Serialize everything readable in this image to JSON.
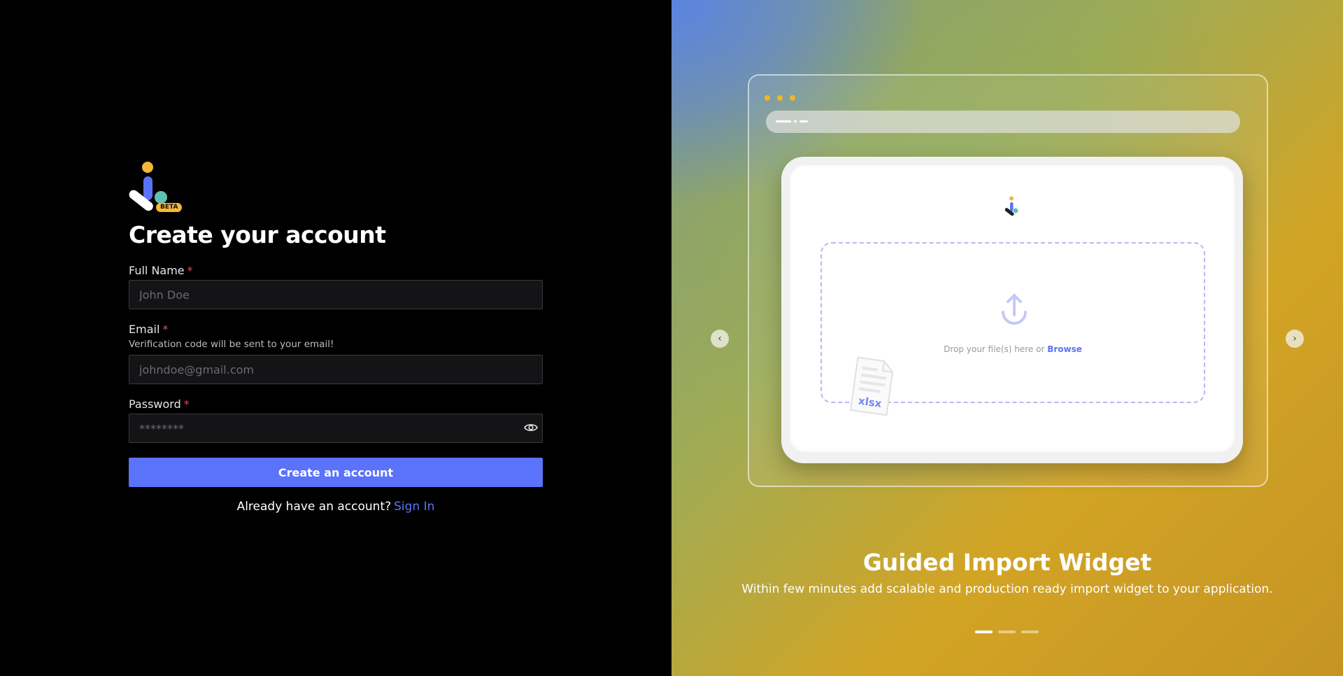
{
  "brand": {
    "badge": "BETA",
    "colors": {
      "accent": "#5b72fb",
      "yellow": "#f4b73a",
      "teal": "#5fc0b2",
      "required": "#e5484d"
    }
  },
  "form": {
    "title": "Create your account",
    "full_name": {
      "label": "Full Name",
      "required": "*",
      "placeholder": "John Doe",
      "value": ""
    },
    "email": {
      "label": "Email",
      "required": "*",
      "hint": "Verification code will be sent to your email!",
      "placeholder": "johndoe@gmail.com",
      "value": ""
    },
    "password": {
      "label": "Password",
      "required": "*",
      "placeholder": "********",
      "value": "",
      "toggle_icon": "eye-icon"
    },
    "submit_label": "Create an account",
    "signin_prompt": "Already have an account?",
    "signin_link": "Sign In"
  },
  "carousel": {
    "slide_title": "Guided Import Widget",
    "slide_description": "Within few minutes add scalable and production ready import widget to your application.",
    "prev_icon": "chevron-left-icon",
    "prev_glyph": "‹",
    "next_icon": "chevron-right-icon",
    "next_glyph": "›",
    "slide_count": 3,
    "active_slide": 1,
    "preview": {
      "drop_text": "Drop your file(s) here or",
      "browse_label": "Browse",
      "file_label": "xlsx"
    }
  }
}
